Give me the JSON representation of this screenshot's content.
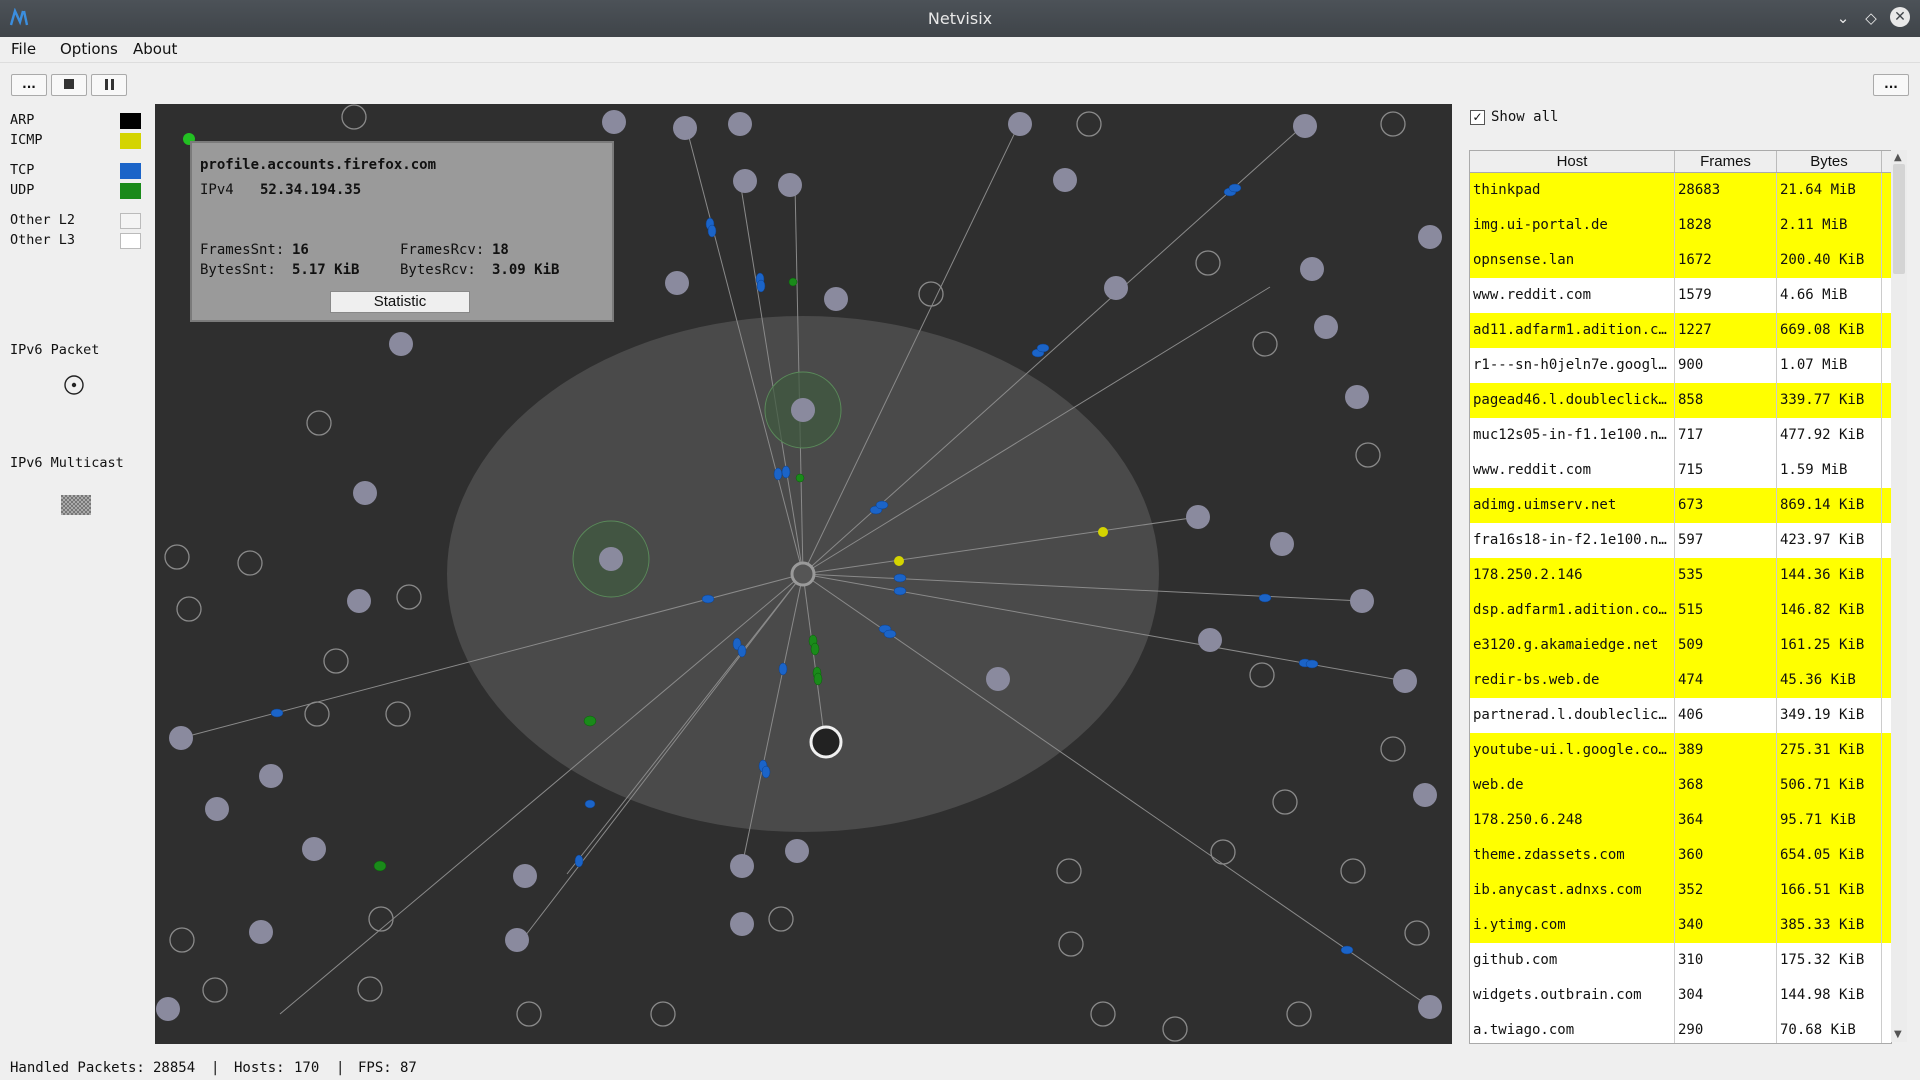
{
  "window": {
    "title": "Netvisix"
  },
  "menu": [
    "File",
    "Options",
    "About"
  ],
  "toolbar": {
    "browse_label": "...",
    "right_browse_label": "..."
  },
  "legend": {
    "items": [
      {
        "label": "ARP",
        "color": "#000000"
      },
      {
        "label": "ICMP",
        "color": "#d4d400"
      },
      {
        "label": "TCP",
        "color": "#1b64c8"
      },
      {
        "label": "UDP",
        "color": "#1a8a1a"
      },
      {
        "label": "Other L2",
        "color": "#f4f4f4"
      },
      {
        "label": "Other L3",
        "color": "#ffffff"
      }
    ],
    "ipv6_packet": "IPv6 Packet",
    "ipv6_multicast": "IPv6 Multicast"
  },
  "tooltip": {
    "host": "profile.accounts.firefox.com",
    "ip_label": "IPv4",
    "ip": "52.34.194.35",
    "frames_snt_label": "FramesSnt:",
    "frames_snt": "16",
    "frames_rcv_label": "FramesRcv:",
    "frames_rcv": "18",
    "bytes_snt_label": "BytesSnt:",
    "bytes_snt": "5.17 KiB",
    "bytes_rcv_label": "BytesRcv:",
    "bytes_rcv": "3.09 KiB",
    "button": "Statistic"
  },
  "hosts_panel": {
    "show_all_label": "Show all",
    "show_all_checked": true,
    "columns": [
      "Host",
      "Frames",
      "Bytes"
    ],
    "highlight_color": "#ffff00",
    "rows": [
      {
        "host": "thinkpad",
        "frames": "28683",
        "bytes": "21.64 MiB",
        "hl": true
      },
      {
        "host": "img.ui-portal.de",
        "frames": "1828",
        "bytes": "2.11 MiB",
        "hl": true
      },
      {
        "host": "opnsense.lan",
        "frames": "1672",
        "bytes": "200.40 KiB",
        "hl": true
      },
      {
        "host": "www.reddit.com",
        "frames": "1579",
        "bytes": "4.66 MiB",
        "hl": false
      },
      {
        "host": "ad11.adfarm1.adition.c…",
        "frames": "1227",
        "bytes": "669.08 KiB",
        "hl": true
      },
      {
        "host": "r1---sn-h0jeln7e.googl…",
        "frames": "900",
        "bytes": "1.07 MiB",
        "hl": false
      },
      {
        "host": "pagead46.l.doubleclick…",
        "frames": "858",
        "bytes": "339.77 KiB",
        "hl": true
      },
      {
        "host": "muc12s05-in-f1.1e100.n…",
        "frames": "717",
        "bytes": "477.92 KiB",
        "hl": false
      },
      {
        "host": "www.reddit.com",
        "frames": "715",
        "bytes": "1.59 MiB",
        "hl": false
      },
      {
        "host": "adimg.uimserv.net",
        "frames": "673",
        "bytes": "869.14 KiB",
        "hl": true
      },
      {
        "host": "fra16s18-in-f2.1e100.n…",
        "frames": "597",
        "bytes": "423.97 KiB",
        "hl": false
      },
      {
        "host": "178.250.2.146",
        "frames": "535",
        "bytes": "144.36 KiB",
        "hl": true
      },
      {
        "host": "dsp.adfarm1.adition.co…",
        "frames": "515",
        "bytes": "146.82 KiB",
        "hl": true
      },
      {
        "host": "e3120.g.akamaiedge.net",
        "frames": "509",
        "bytes": "161.25 KiB",
        "hl": true
      },
      {
        "host": "redir-bs.web.de",
        "frames": "474",
        "bytes": "45.36 KiB",
        "hl": true
      },
      {
        "host": "partnerad.l.doubleclic…",
        "frames": "406",
        "bytes": "349.19 KiB",
        "hl": false
      },
      {
        "host": "youtube-ui.l.google.co…",
        "frames": "389",
        "bytes": "275.31 KiB",
        "hl": true
      },
      {
        "host": "web.de",
        "frames": "368",
        "bytes": "506.71 KiB",
        "hl": true
      },
      {
        "host": "178.250.6.248",
        "frames": "364",
        "bytes": "95.71 KiB",
        "hl": true
      },
      {
        "host": "theme.zdassets.com",
        "frames": "360",
        "bytes": "654.05 KiB",
        "hl": true
      },
      {
        "host": "ib.anycast.adnxs.com",
        "frames": "352",
        "bytes": "166.51 KiB",
        "hl": true
      },
      {
        "host": "i.ytimg.com",
        "frames": "340",
        "bytes": "385.33 KiB",
        "hl": true
      },
      {
        "host": "github.com",
        "frames": "310",
        "bytes": "175.32 KiB",
        "hl": false
      },
      {
        "host": "widgets.outbrain.com",
        "frames": "304",
        "bytes": "144.98 KiB",
        "hl": false
      },
      {
        "host": "a.twiago.com",
        "frames": "290",
        "bytes": "70.68 KiB",
        "hl": false
      }
    ]
  },
  "status": {
    "packets_label": "Handled Packets:",
    "packets": "28854",
    "hosts_label": "Hosts:",
    "hosts": "170",
    "fps_label": "FPS:",
    "fps": "87",
    "sep": "|"
  }
}
